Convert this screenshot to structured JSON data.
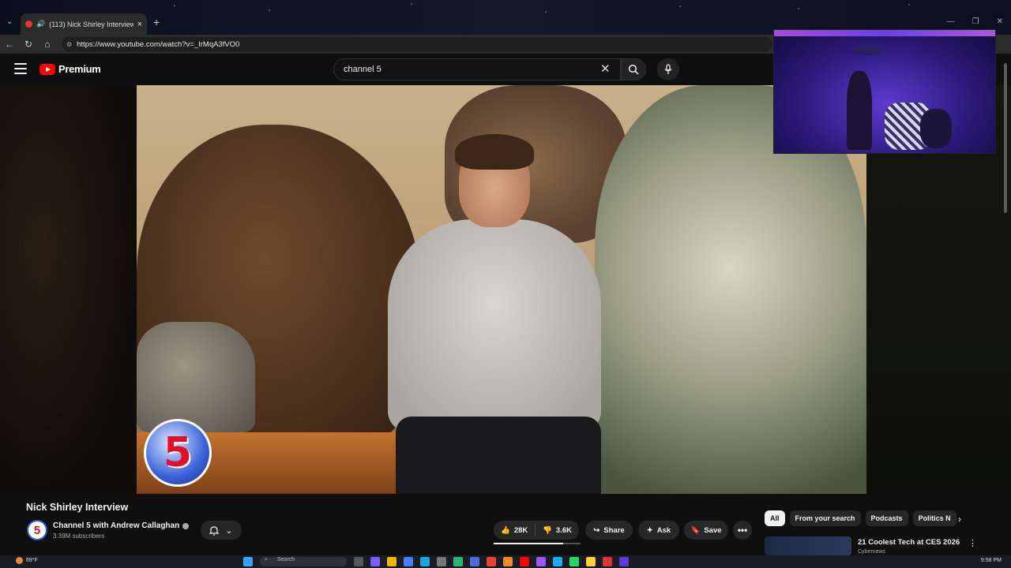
{
  "browser": {
    "tab_title": "(113) Nick Shirley Interview -",
    "url": "https://www.youtube.com/watch?v=_IrMqA3fVO0",
    "new_tab": "+",
    "tab_close": "×"
  },
  "youtube": {
    "logo_text": "Premium",
    "search_query": "channel 5"
  },
  "video": {
    "overlay_logo_text": "5",
    "title": "Nick Shirley Interview"
  },
  "channel": {
    "avatar_text": "5",
    "name": "Channel 5 with Andrew Callaghan",
    "subscribers": "3.39M subscribers"
  },
  "actions": {
    "likes": "28K",
    "dislikes": "3.6K",
    "like_ratio": 0.8,
    "share": "Share",
    "ask": "Ask",
    "save": "Save",
    "more": "•••"
  },
  "chips": [
    "All",
    "From your search",
    "Podcasts",
    "Politics N"
  ],
  "recommendation": {
    "title": "21 Coolest Tech at CES 2026",
    "channel": "Cybernews"
  },
  "taskbar": {
    "weather": "69°F",
    "search": "Search",
    "time": "9:58 PM"
  },
  "colors": {
    "yt_red": "#ff0000",
    "background": "#0f0f0f",
    "chip_active": "#f1f1f1"
  }
}
